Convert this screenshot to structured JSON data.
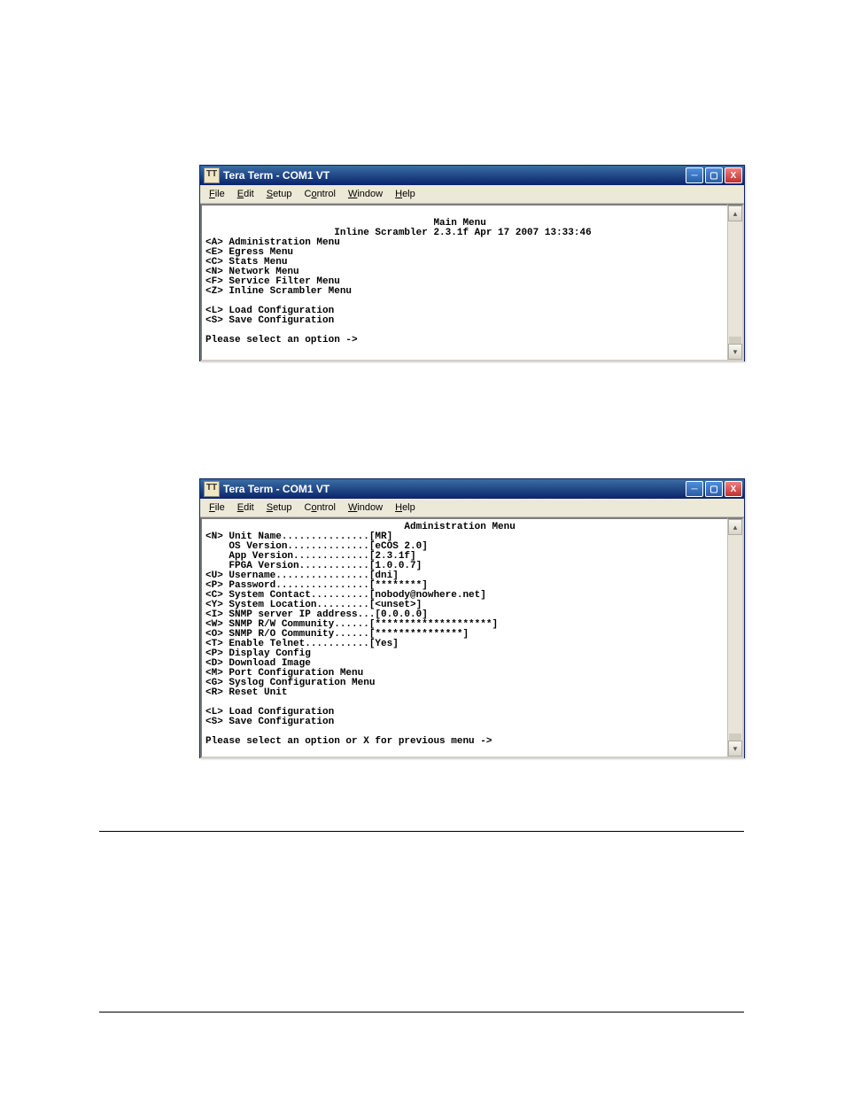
{
  "window1": {
    "title": "Tera Term - COM1 VT",
    "menu": [
      "File",
      "Edit",
      "Setup",
      "Control",
      "Window",
      "Help"
    ],
    "menu_underline_idx": [
      0,
      0,
      0,
      0,
      0,
      0
    ],
    "terminal": {
      "heading_center": "Main Menu",
      "subheading_center": "Inline Scrambler 2.3.1f Apr 17 2007 13:33:46",
      "items": [
        {
          "key": "A",
          "label": "Administration Menu"
        },
        {
          "key": "E",
          "label": "Egress Menu"
        },
        {
          "key": "C",
          "label": "Stats Menu"
        },
        {
          "key": "N",
          "label": "Network Menu"
        },
        {
          "key": "F",
          "label": "Service Filter Menu"
        },
        {
          "key": "Z",
          "label": "Inline Scrambler Menu"
        }
      ],
      "extra": [
        {
          "key": "L",
          "label": "Load Configuration"
        },
        {
          "key": "S",
          "label": "Save Configuration"
        }
      ],
      "prompt": "Please select an option ->"
    }
  },
  "window2": {
    "title": "Tera Term - COM1 VT",
    "menu": [
      "File",
      "Edit",
      "Setup",
      "Control",
      "Window",
      "Help"
    ],
    "terminal": {
      "heading_center": "Administration Menu",
      "fields": [
        {
          "key": "N",
          "label": "Unit Name",
          "dots": 15,
          "value": "[MR]"
        },
        {
          "key": "",
          "label": "OS Version",
          "dots": 14,
          "value": "[eCOS 2.0]"
        },
        {
          "key": "",
          "label": "App Version",
          "dots": 13,
          "value": "[2.3.1f]"
        },
        {
          "key": "",
          "label": "FPGA Version",
          "dots": 12,
          "value": "[1.0.0.7]"
        },
        {
          "key": "U",
          "label": "Username",
          "dots": 16,
          "value": "[dni]"
        },
        {
          "key": "P",
          "label": "Password",
          "dots": 16,
          "value": "[********]"
        },
        {
          "key": "C",
          "label": "System Contact",
          "dots": 10,
          "value": "[nobody@nowhere.net]"
        },
        {
          "key": "Y",
          "label": "System Location",
          "dots": 9,
          "value": "[<unset>]"
        },
        {
          "key": "I",
          "label": "SNMP server IP address",
          "dots": 3,
          "value": "[0.0.0.0]"
        },
        {
          "key": "W",
          "label": "SNMP R/W Community",
          "dots": 6,
          "value": "[********************]"
        },
        {
          "key": "O",
          "label": "SNMP R/O Community",
          "dots": 6,
          "value": "[***************]"
        },
        {
          "key": "T",
          "label": "Enable Telnet",
          "dots": 11,
          "value": "[Yes]"
        },
        {
          "key": "P",
          "label": "Display Config",
          "dots": 0,
          "value": ""
        },
        {
          "key": "D",
          "label": "Download Image",
          "dots": 0,
          "value": ""
        },
        {
          "key": "M",
          "label": "Port Configuration Menu",
          "dots": 0,
          "value": ""
        },
        {
          "key": "G",
          "label": "Syslog Configuration Menu",
          "dots": 0,
          "value": ""
        },
        {
          "key": "R",
          "label": "Reset Unit",
          "dots": 0,
          "value": ""
        }
      ],
      "extra": [
        {
          "key": "L",
          "label": "Load Configuration"
        },
        {
          "key": "S",
          "label": "Save Configuration"
        }
      ],
      "prompt": "Please select an option or X for previous menu ->"
    }
  }
}
